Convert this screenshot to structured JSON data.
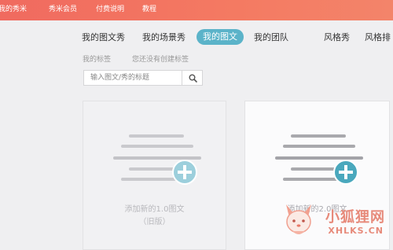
{
  "top_nav": {
    "items": [
      "我的秀米",
      "秀米会员",
      "付费说明",
      "教程"
    ]
  },
  "tabs": {
    "items": [
      "我的图文秀",
      "我的场景秀",
      "我的图文",
      "我的团队",
      "风格秀",
      "风格排"
    ],
    "active": "我的图文"
  },
  "tags": {
    "label": "我的标签",
    "empty_text": "您还没有创建标签"
  },
  "search": {
    "placeholder": "输入图文/秀的标题",
    "icon": "search-icon"
  },
  "cards": [
    {
      "line1": "添加新的1.0图文",
      "line2": "（旧版）",
      "icon": "plus-circle-icon"
    },
    {
      "line1": "添加新的2.0图文",
      "icon": "plus-circle-icon"
    }
  ],
  "watermark": {
    "text": "小狐狸网",
    "url": "XHLKS.CN"
  },
  "colors": {
    "topbar": "#f06a5f",
    "accent": "#5bb3c9",
    "background": "#efeff1"
  }
}
